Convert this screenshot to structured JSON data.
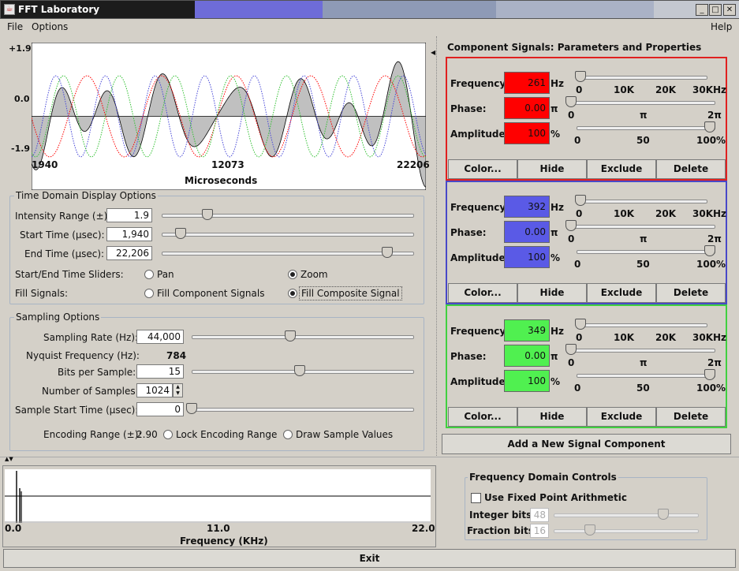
{
  "window": {
    "title": "FFT Laboratory"
  },
  "menu": {
    "file": "File",
    "options": "Options",
    "help": "Help"
  },
  "time_plot": {
    "y_max": "+1.9",
    "y_mid": "0.0",
    "y_min": "-1.9",
    "x_start": "1940",
    "x_mid": "12073",
    "x_end": "22206",
    "x_label": "Microseconds"
  },
  "time_options": {
    "title": "Time Domain Display Options",
    "intensity_label": "Intensity Range (±):",
    "intensity_value": "1.9",
    "start_label": "Start Time (μsec):",
    "start_value": "1,940",
    "end_label": "End Time (μsec):",
    "end_value": "22,206",
    "sliders_label": "Start/End Time Sliders:",
    "pan": "Pan",
    "zoom": "Zoom",
    "fill_label": "Fill Signals:",
    "fill_component": "Fill Component Signals",
    "fill_composite": "Fill Composite Signal"
  },
  "sampling": {
    "title": "Sampling Options",
    "rate_label": "Sampling Rate (Hz):",
    "rate_value": "44,000",
    "nyquist_label": "Nyquist Frequency (Hz):",
    "nyquist_value": "784",
    "bits_label": "Bits per Sample:",
    "bits_value": "15",
    "samples_label": "Number of Samples:",
    "samples_value": "1024",
    "start_label": "Sample Start Time (μsec):",
    "start_value": "0",
    "encoding_label": "Encoding Range (±):",
    "encoding_value": "2.90",
    "lock_label": "Lock Encoding Range",
    "draw_label": "Draw Sample Values"
  },
  "components": {
    "title": "Component Signals:  Parameters and Properties",
    "freq_label": "Frequency:",
    "phase_label": "Phase:",
    "amp_label": "Amplitude:",
    "hz": "Hz",
    "pi": "π",
    "pct": "%",
    "freq_ticks": [
      "0",
      "10K",
      "20K",
      "30KHz"
    ],
    "phase_ticks": [
      "0",
      "π",
      "2π"
    ],
    "amp_ticks": [
      "0",
      "50",
      "100%"
    ],
    "btn_color": "Color...",
    "btn_hide": "Hide",
    "btn_exclude": "Exclude",
    "btn_delete": "Delete",
    "items": [
      {
        "frequency": "261",
        "phase": "0.00",
        "amplitude": "100",
        "color": "#ff0000",
        "border": "#e02020"
      },
      {
        "frequency": "392",
        "phase": "0.00",
        "amplitude": "100",
        "color": "#5a5ae6",
        "border": "#4848c8"
      },
      {
        "frequency": "349",
        "phase": "0.00",
        "amplitude": "100",
        "color": "#50f050",
        "border": "#40d040"
      }
    ],
    "add_button": "Add a New Signal Component"
  },
  "freq_plot": {
    "x_start": "0.0",
    "x_mid": "11.0",
    "x_end": "22.0",
    "x_label": "Frequency  (KHz)"
  },
  "freq_controls": {
    "title": "Frequency Domain Controls",
    "fixed_label": "Use Fixed Point Arithmetic",
    "int_label": "Integer bits:",
    "int_value": "48",
    "frac_label": "Fraction bits:",
    "frac_value": "16"
  },
  "exit_button": "Exit"
}
